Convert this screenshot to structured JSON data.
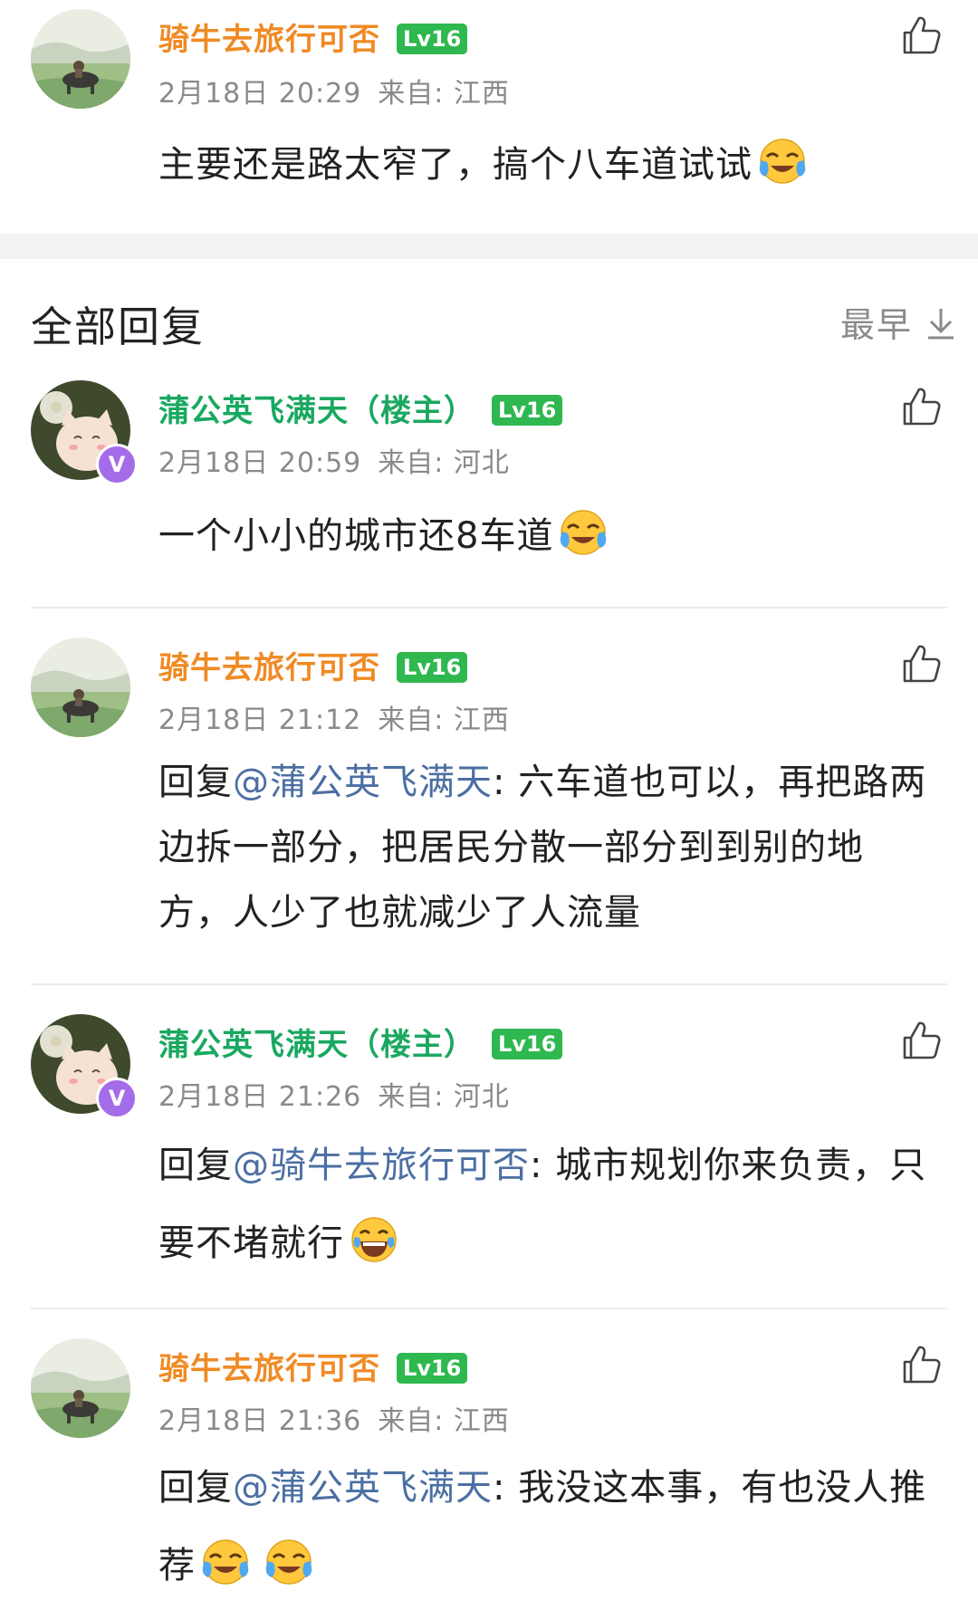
{
  "top_comment": {
    "username": "骑牛去旅行可否",
    "level": "Lv16",
    "date": "2月18日 20:29",
    "location": "来自: 江西",
    "text": "主要还是路太窄了，搞个八车道试试"
  },
  "replies_header": {
    "title": "全部回复",
    "sort_label": "最早"
  },
  "replies": [
    {
      "username": "蒲公英飞满天",
      "op_tag": "（楼主）",
      "level": "Lv16",
      "date": "2月18日 20:59",
      "location": "来自: 河北",
      "text": "一个小小的城市还8车道"
    },
    {
      "username": "骑牛去旅行可否",
      "level": "Lv16",
      "date": "2月18日 21:12",
      "location": "来自: 江西",
      "reply_prefix": "回复",
      "mention": "@蒲公英飞满天",
      "text": ": 六车道也可以，再把路两边拆一部分，把居民分散一部分到到别的地方，人少了也就减少了人流量"
    },
    {
      "username": "蒲公英飞满天",
      "op_tag": "（楼主）",
      "level": "Lv16",
      "date": "2月18日 21:26",
      "location": "来自: 河北",
      "reply_prefix": "回复",
      "mention": "@骑牛去旅行可否",
      "text": ": 城市规划你来负责，只要不堵就行"
    },
    {
      "username": "骑牛去旅行可否",
      "level": "Lv16",
      "date": "2月18日 21:36",
      "location": "来自: 江西",
      "reply_prefix": "回复",
      "mention": "@蒲公英飞满天",
      "text": ": 我没这本事，有也没人推荐"
    }
  ],
  "verified_badge": "V",
  "colors": {
    "username_orange": "#f08a24",
    "username_green": "#1aa860",
    "level_badge": "#2fb84f",
    "mention_blue": "#4b6fa3",
    "meta_gray": "#8a8a8a",
    "verified_purple": "#a46ce8"
  },
  "icons": {
    "like": "thumbs-up-icon",
    "sort": "arrow-down-icon",
    "emoji_cry_laugh": "crying-laughing-emoji-icon",
    "emoji_tears_of_joy": "tears-of-joy-emoji-icon"
  }
}
